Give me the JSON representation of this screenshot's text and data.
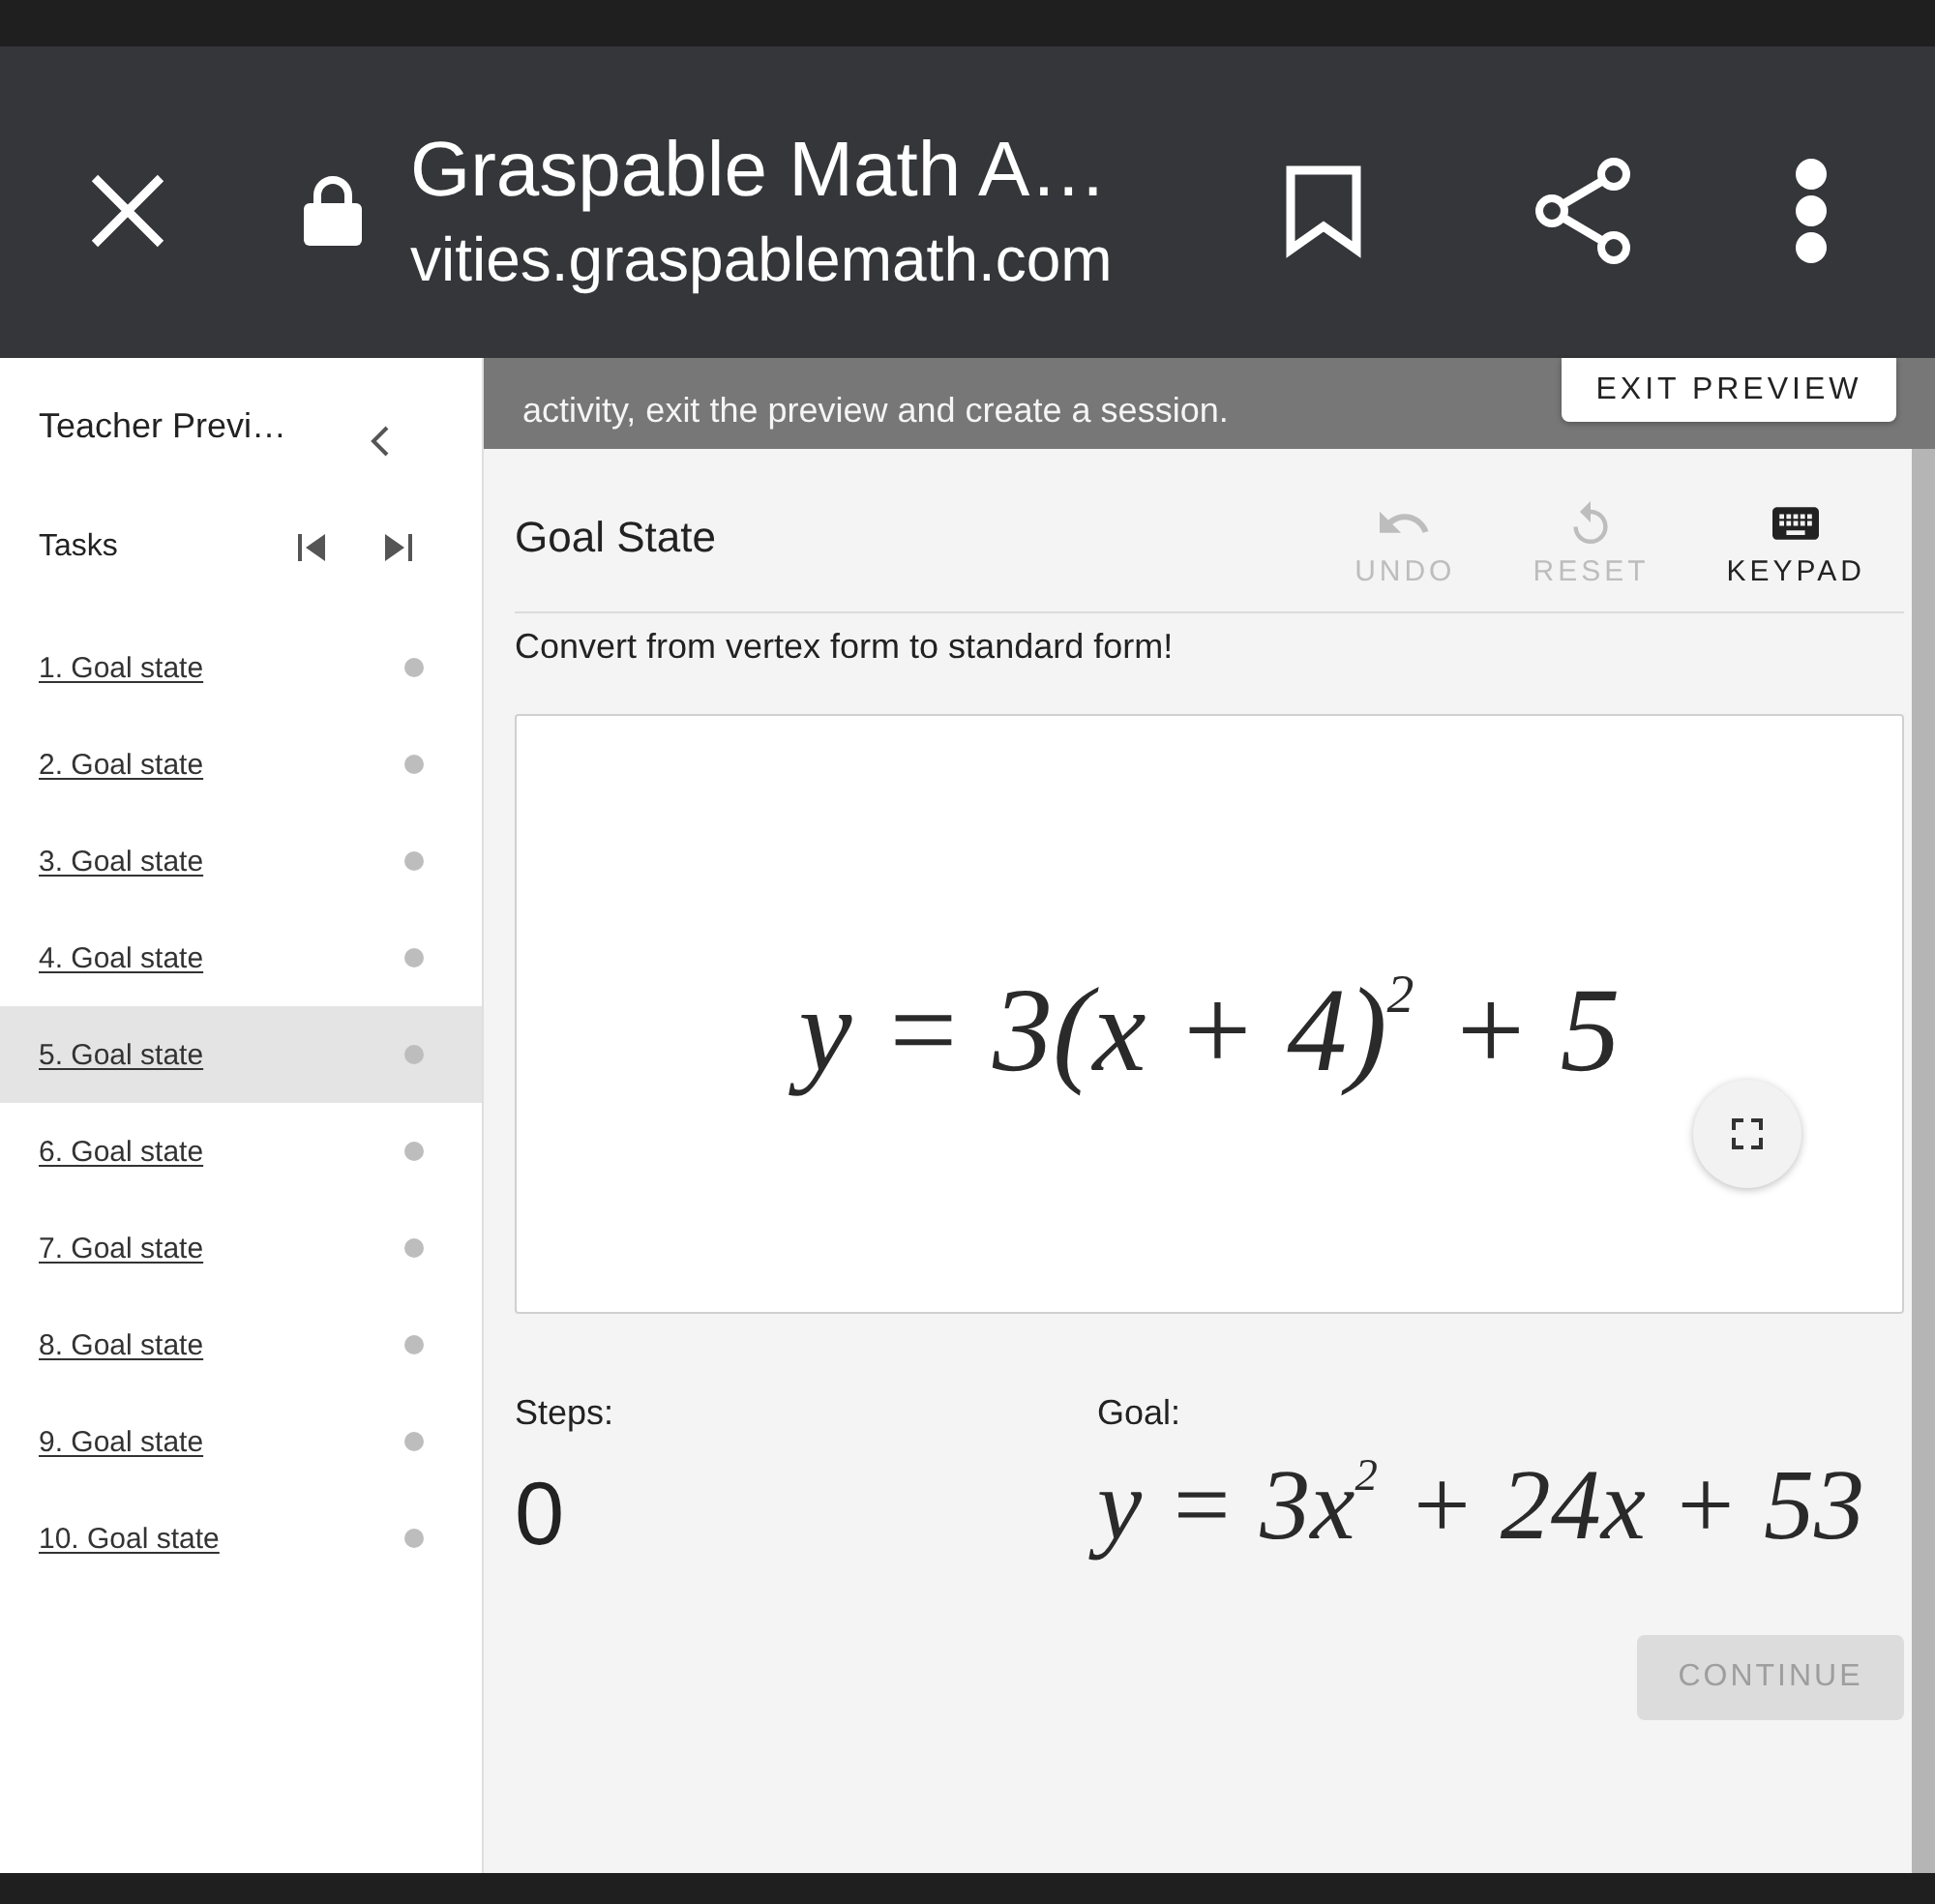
{
  "browser_bar": {
    "title": "Graspable Math A…",
    "url": "vities.graspablemath.com"
  },
  "banner": {
    "text": "activity, exit the preview and create a session.",
    "button": "EXIT PREVIEW"
  },
  "sidebar": {
    "title": "Teacher Previ…",
    "section": "Tasks",
    "items": [
      {
        "label": "1. Goal state",
        "selected": false
      },
      {
        "label": "2. Goal state",
        "selected": false
      },
      {
        "label": "3. Goal state",
        "selected": false
      },
      {
        "label": "4. Goal state",
        "selected": false
      },
      {
        "label": "5. Goal state",
        "selected": true
      },
      {
        "label": "6. Goal state",
        "selected": false
      },
      {
        "label": "7. Goal state",
        "selected": false
      },
      {
        "label": "8. Goal state",
        "selected": false
      },
      {
        "label": "9. Goal state",
        "selected": false
      },
      {
        "label": "10. Goal state",
        "selected": false
      }
    ]
  },
  "task": {
    "title": "Goal State",
    "tools": [
      {
        "kind": "undo",
        "label": "UNDO",
        "disabled": true
      },
      {
        "kind": "reset",
        "label": "RESET",
        "disabled": true
      },
      {
        "kind": "keypad",
        "label": "KEYPAD",
        "disabled": false
      }
    ],
    "instruction": "Convert from vertex form to standard form!",
    "expression": "y = 3(x + 4)$^{2}$ + 5",
    "steps": {
      "label": "Steps:",
      "value": "0"
    },
    "goal": {
      "label": "Goal:",
      "expression": "y = 3x$^{2}$ + 24x + 53"
    },
    "continue": {
      "label": "CONTINUE",
      "disabled": true
    }
  }
}
